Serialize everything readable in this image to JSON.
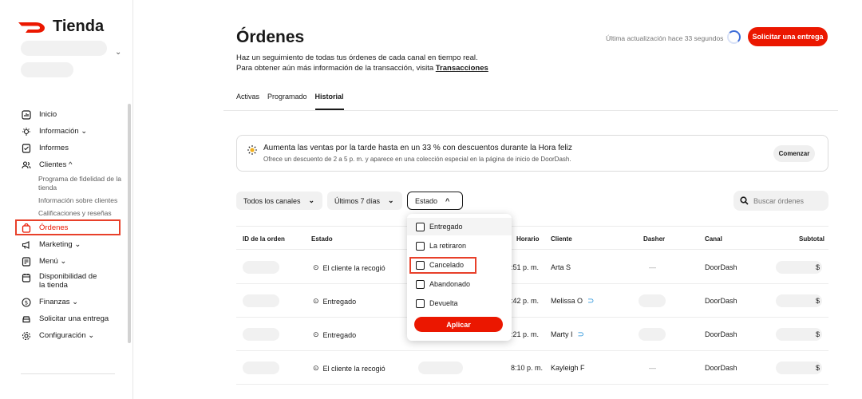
{
  "brand": {
    "name": "Tienda",
    "color": "#eb1700"
  },
  "sidebar": {
    "items": [
      {
        "label": "Inicio",
        "icon": "home-chart-icon"
      },
      {
        "label": "Información ⌄",
        "icon": "lightbulb-icon"
      },
      {
        "label": "Informes",
        "icon": "report-icon"
      },
      {
        "label": "Clientes ^",
        "icon": "people-icon"
      },
      {
        "label": "Órdenes",
        "icon": "bag-icon"
      },
      {
        "label": "Marketing ⌄",
        "icon": "megaphone-icon"
      },
      {
        "label": "Menú ⌄",
        "icon": "menu-icon"
      },
      {
        "label": "Disponibilidad de la tienda",
        "icon": "calendar-icon"
      },
      {
        "label": "Finanzas ⌄",
        "icon": "dollar-icon"
      },
      {
        "label": "Solicitar una entrega",
        "icon": "car-icon"
      },
      {
        "label": "Configuración ⌄",
        "icon": "gear-icon"
      }
    ],
    "subitems": [
      "Programa de fidelidad de la tienda",
      "Información sobre clientes",
      "Calificaciones y reseñas"
    ]
  },
  "header": {
    "title": "Órdenes",
    "desc_line1": "Haz un seguimiento de todas tus órdenes de cada canal en tiempo real.",
    "desc_line2_prefix": "Para obtener aún más información de la transacción, visita ",
    "desc_link": "Transacciones",
    "update": "Última actualización hace 33 segundos",
    "primary_btn": "Solicitar una entrega"
  },
  "tabs": [
    "Activas",
    "Programado",
    "Historial"
  ],
  "banner": {
    "headline": "Aumenta las ventas por la tarde hasta en un 33 % con descuentos durante la Hora feliz",
    "sub": "Ofrece un descuento de 2 a 5 p. m. y aparece en una colección especial en la página de inicio de DoorDash.",
    "btn": "Comenzar"
  },
  "filters": {
    "channels": "Todos los canales",
    "range": "Últimos 7 días",
    "status": "Estado",
    "search_placeholder": "Buscar órdenes"
  },
  "table": {
    "headers": [
      "ID de la orden",
      "Estado",
      "Horario",
      "Cliente",
      "Dasher",
      "Canal",
      "Subtotal"
    ],
    "rows": [
      {
        "status": "El cliente la recogió",
        "time": ":51 p. m.",
        "customer": "Arta S",
        "dasher": "—",
        "channel": "DoorDash",
        "subtotal": "$"
      },
      {
        "status": "Entregado",
        "time": ":42 p. m.",
        "customer": "Melissa O",
        "dasher": "",
        "channel": "DoorDash",
        "subtotal": "$"
      },
      {
        "status": "Entregado",
        "time": ":21 p. m.",
        "customer": "Marty I",
        "dasher": "",
        "channel": "DoorDash",
        "subtotal": "$"
      },
      {
        "status": "El cliente la recogió",
        "time": "8:10 p. m.",
        "customer": "Kayleigh F",
        "dasher": "—",
        "channel": "DoorDash",
        "subtotal": "$"
      }
    ]
  },
  "dropdown": {
    "options": [
      "Entregado",
      "La retiraron",
      "Cancelado",
      "Abandonado",
      "Devuelta"
    ],
    "apply": "Aplicar"
  }
}
